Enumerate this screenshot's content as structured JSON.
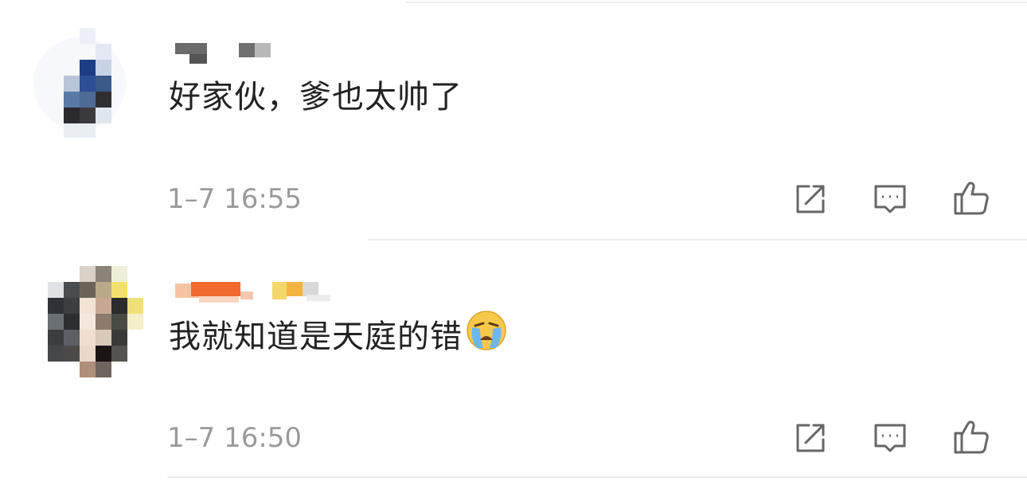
{
  "comments": [
    {
      "username": "",
      "text": "好家伙，爹也太帅了",
      "timestamp": "1–7 16:55",
      "has_emoji": false,
      "avatar_colors": [
        "#e8ecf6",
        "#1c3d86",
        "#5a7aa6",
        "#2f2f33",
        "#9aa4b4",
        "#3a5a8a",
        "#dfe7ee"
      ]
    },
    {
      "username": "",
      "text": "我就知道是天庭的错",
      "timestamp": "1–7 16:50",
      "has_emoji": true,
      "emoji": "loudly-crying-face",
      "avatar_colors": [
        "#3c3f42",
        "#8b8478",
        "#d8c9b8",
        "#f3e06a",
        "#2b2b2b",
        "#6a6f74",
        "#b08f7a"
      ]
    }
  ],
  "actions": {
    "repost": "share-icon",
    "reply": "comment-icon",
    "like": "thumbs-up-icon"
  },
  "colors": {
    "text": "#222222",
    "timestamp": "#9a9a9a",
    "icon": "#666666",
    "divider": "#eeeeee"
  }
}
